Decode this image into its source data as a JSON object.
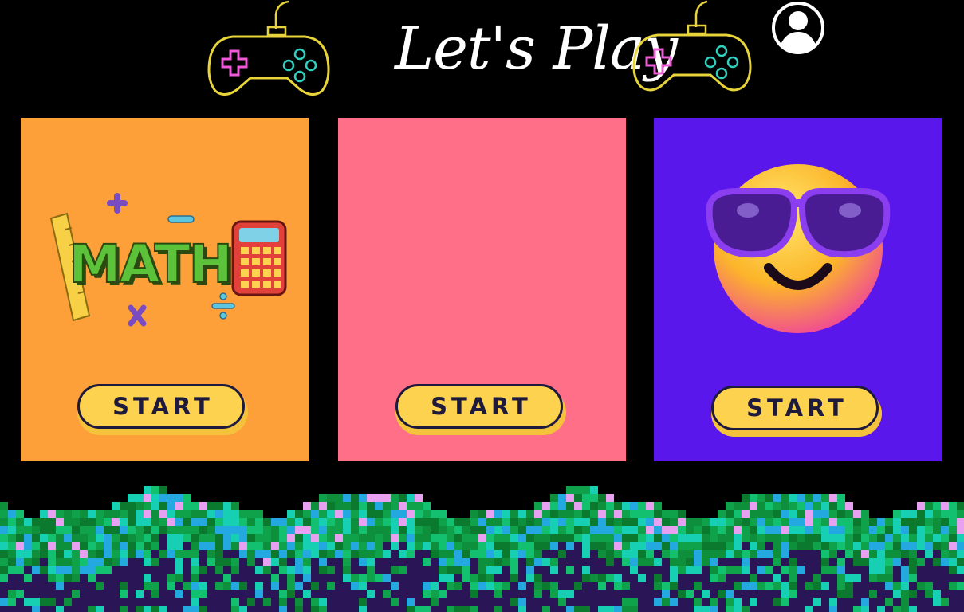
{
  "header": {
    "title": "Let's Play",
    "left_icon": "gamepad-icon",
    "right_icon": "gamepad-icon",
    "profile_icon": "user-profile-icon"
  },
  "cards": [
    {
      "art_text": "MATH",
      "art_icons": [
        "ruler-icon",
        "calculator-icon",
        "plus-icon",
        "minus-icon",
        "times-icon",
        "divide-icon"
      ],
      "background": "#fea03a",
      "button_label": "START"
    },
    {
      "background": "#ff6f87",
      "button_label": "START"
    },
    {
      "art_icons": [
        "sunglasses-emoji-icon"
      ],
      "background": "#5a17eb",
      "button_label": "START"
    }
  ],
  "colors": {
    "page_background": "#000000",
    "button_fill": "#fdd24e",
    "button_outline": "#1d1a3d",
    "neon_yellow": "#e6d43a",
    "neon_pink": "#f05ad8",
    "neon_teal": "#2fd0c0"
  }
}
